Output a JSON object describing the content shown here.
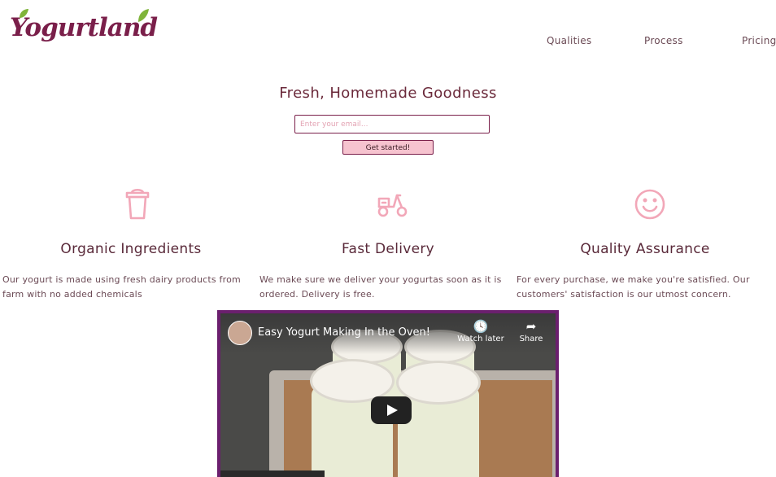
{
  "brand": {
    "logo_text": "Yogurtland"
  },
  "nav": {
    "items": [
      "Qualities",
      "Process",
      "Pricing"
    ]
  },
  "hero": {
    "title": "Fresh, Homemade Goodness",
    "email_placeholder": "Enter your email...",
    "cta_label": "Get started!"
  },
  "features": [
    {
      "icon": "cup-icon",
      "title": "Organic Ingredients",
      "desc": "Our yogurt is made using fresh dairy products from farm with no added chemicals"
    },
    {
      "icon": "scooter-icon",
      "title": "Fast Delivery",
      "desc": "We make sure we deliver your yogurtas soon as it is ordered. Delivery is free."
    },
    {
      "icon": "smile-icon",
      "title": "Quality Assurance",
      "desc": "For every purchase, we make you're satisfied. Our customers' satisfaction is our utmost concern."
    }
  ],
  "video": {
    "title": "Easy Yogurt Making In the Oven!",
    "watch_later": "Watch later",
    "share": "Share"
  },
  "colors": {
    "brand": "#7a1f4a",
    "accent_pink": "#f6c3cf",
    "icon_pink": "#f2a7b8",
    "video_border": "#6b1f6e"
  }
}
